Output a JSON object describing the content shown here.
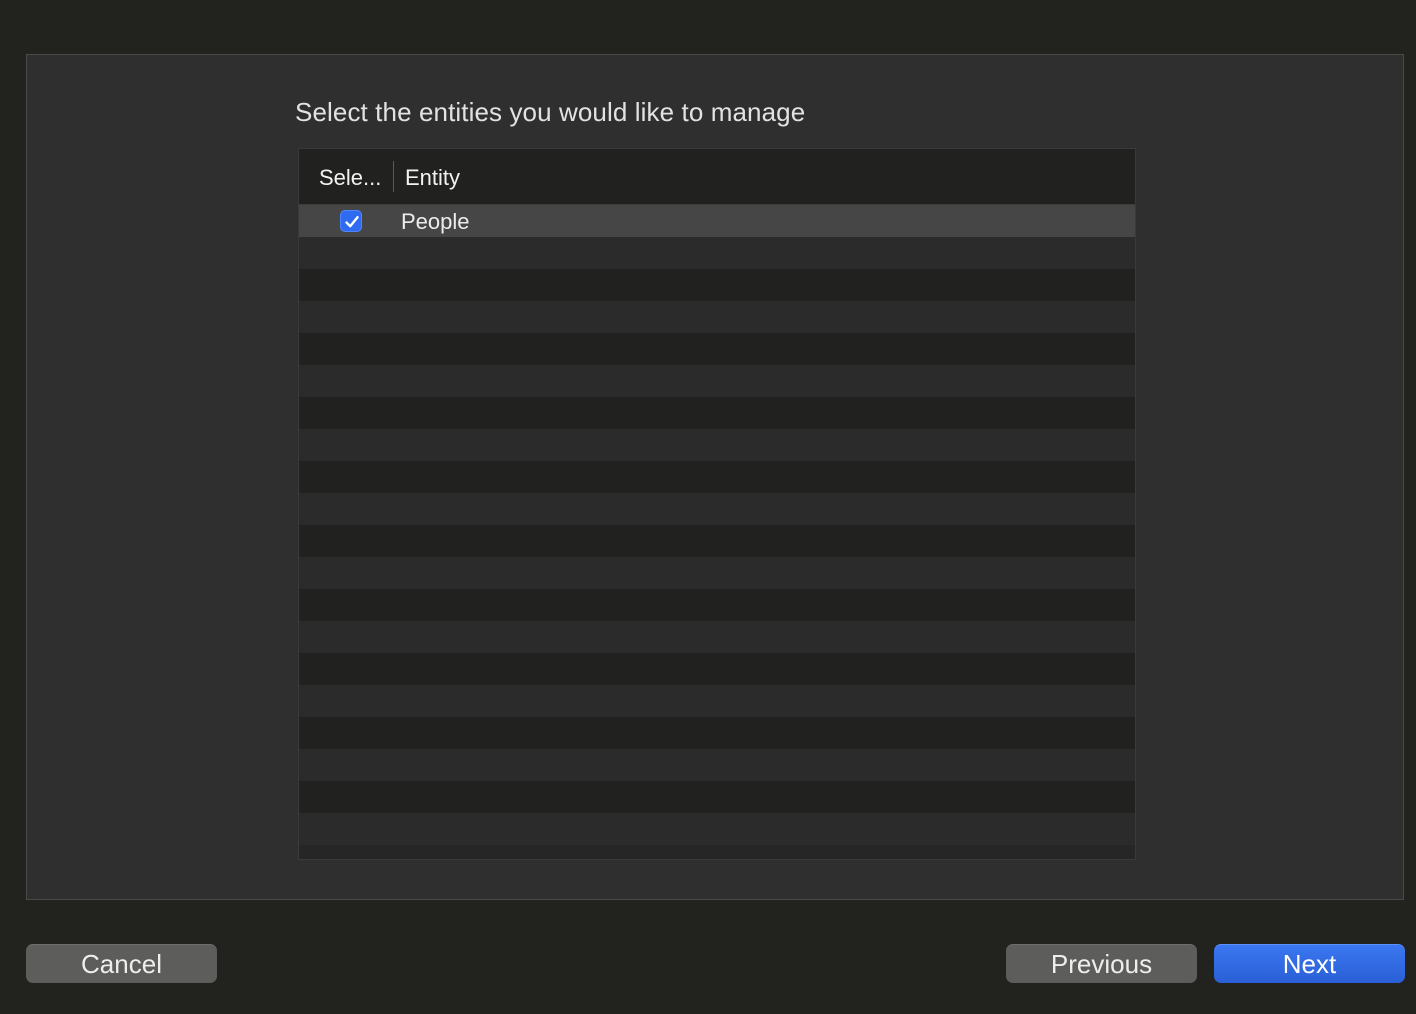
{
  "dialog": {
    "prompt": "Select the entities you would like to manage"
  },
  "table": {
    "columns": [
      "Sele...",
      "Entity"
    ],
    "rows": [
      {
        "selected": true,
        "entity": "People"
      }
    ],
    "empty_row_count": 19
  },
  "buttons": {
    "cancel": "Cancel",
    "previous": "Previous",
    "next": "Next"
  },
  "colors": {
    "accent": "#2f6bf0",
    "background": "#22221f",
    "sheet": "#2f2f2f"
  },
  "icons": {
    "checkbox": "checkmark-icon"
  }
}
